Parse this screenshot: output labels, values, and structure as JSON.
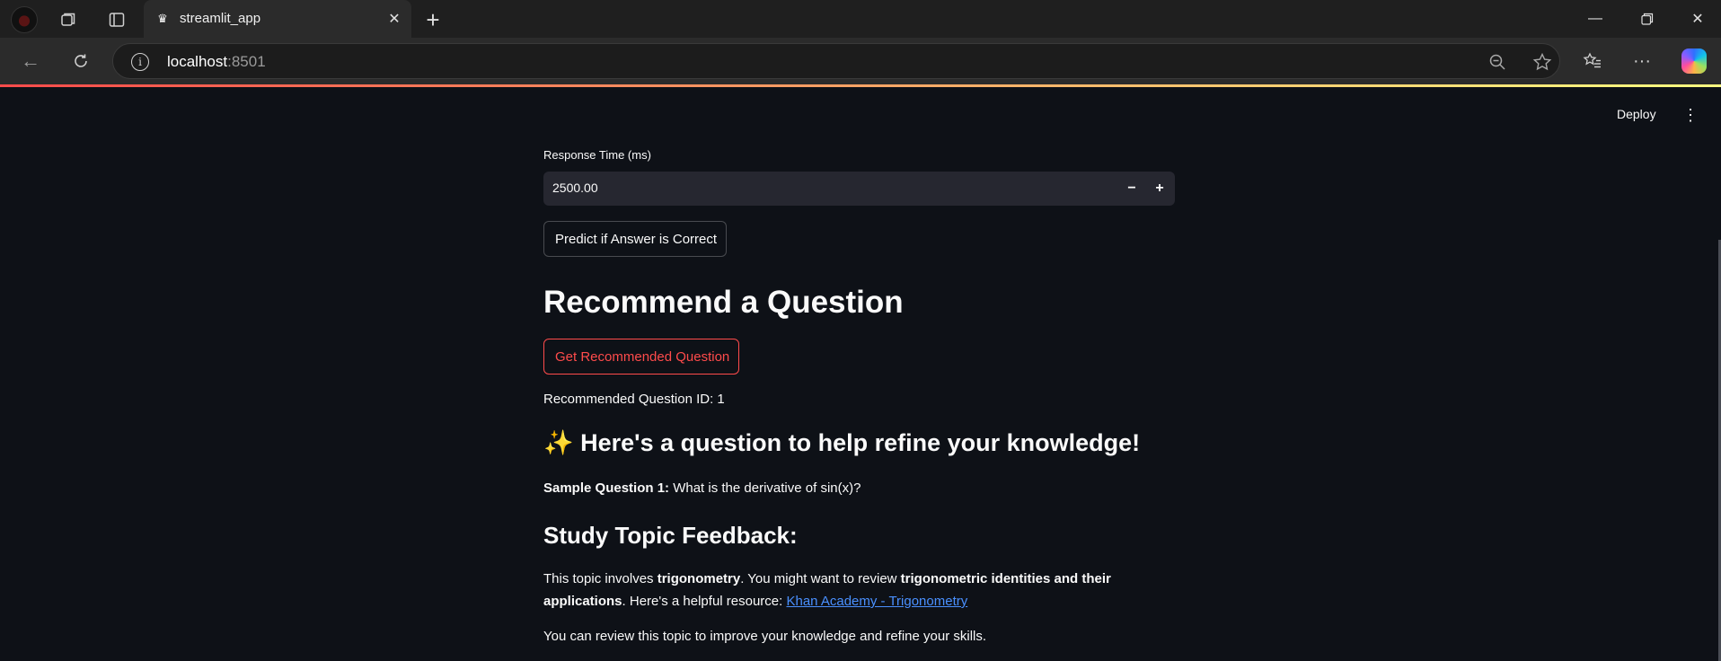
{
  "browser": {
    "tab_title": "streamlit_app",
    "tab_favicon": "crown-icon",
    "url_host": "localhost",
    "url_port": ":8501"
  },
  "app": {
    "header": {
      "deploy_label": "Deploy"
    },
    "number_input": {
      "label": "Response Time (ms)",
      "value": "2500.00",
      "minus": "−",
      "plus": "+"
    },
    "predict_button": "Predict if Answer is Correct",
    "section_title": "Recommend a Question",
    "recommend_button": "Get Recommended Question",
    "recommended_id_text": "Recommended Question ID: 1",
    "question_heading": "✨ Here's a question to help refine your knowledge!",
    "sample_question": {
      "label": "Sample Question 1:",
      "text": " What is the derivative of sin(x)?"
    },
    "feedback_heading": "Study Topic Feedback:",
    "feedback": {
      "part1": "This topic involves ",
      "bold1": "trigonometry",
      "part2": ". You might want to review ",
      "bold2": "trigonometric identities and their applications",
      "part3": ". Here's a helpful resource: ",
      "link_text": "Khan Academy - Trigonometry"
    },
    "closing_text": "You can review this topic to improve your knowledge and refine your skills."
  },
  "colors": {
    "background": "#0e1117",
    "primary": "#ff4b4b",
    "link": "#4a90ff",
    "input_bg": "#262730"
  }
}
